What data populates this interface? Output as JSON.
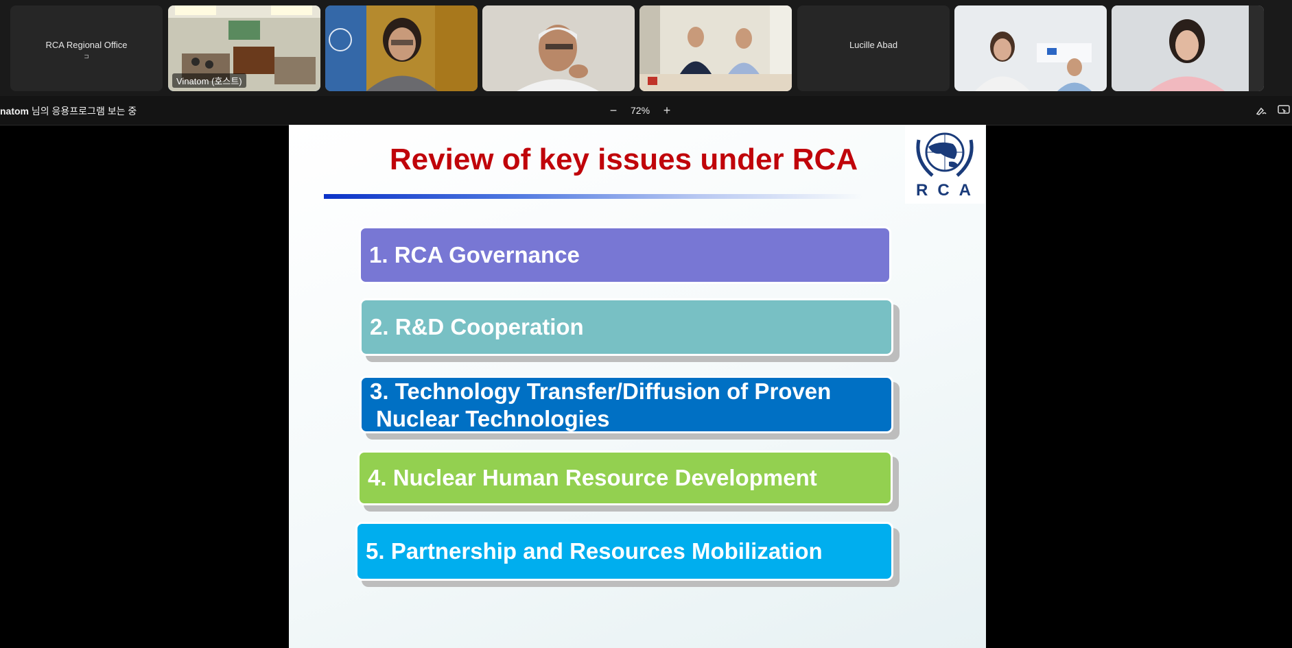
{
  "participants": [
    {
      "id": "rca-office",
      "name": "RCA Regional Office",
      "video": false,
      "mic_glyph": "⊐"
    },
    {
      "id": "vinatom",
      "name": "Vinatom (호스트)",
      "video": true,
      "active": true
    },
    {
      "id": "p3",
      "name": "",
      "video": true
    },
    {
      "id": "p4",
      "name": "",
      "video": true
    },
    {
      "id": "p5",
      "name": "",
      "video": true
    },
    {
      "id": "lucille",
      "name": "Lucille Abad",
      "video": false
    },
    {
      "id": "p7",
      "name": "",
      "video": true
    },
    {
      "id": "p8",
      "name": "",
      "video": true
    }
  ],
  "toolbar": {
    "share_owner": "natom",
    "share_suffix": " 님의 응용프로그램 보는 중",
    "zoom_level": "72%",
    "zoom_out": "−",
    "zoom_in": "+"
  },
  "slide": {
    "title": "Review of key issues under RCA",
    "logo_text": "RCA",
    "issues": [
      {
        "label": "1. RCA Governance",
        "color": "#7877d4"
      },
      {
        "label": "2. R&D Cooperation",
        "color": "#78c0c4"
      },
      {
        "label": "3. Technology Transfer/Diffusion of Proven",
        "label2": "Nuclear Technologies",
        "color": "#0070c4"
      },
      {
        "label": "4. Nuclear Human Resource Development",
        "color": "#93d050"
      },
      {
        "label": "5. Partnership and Resources Mobilization",
        "color": "#00aeee"
      }
    ]
  }
}
